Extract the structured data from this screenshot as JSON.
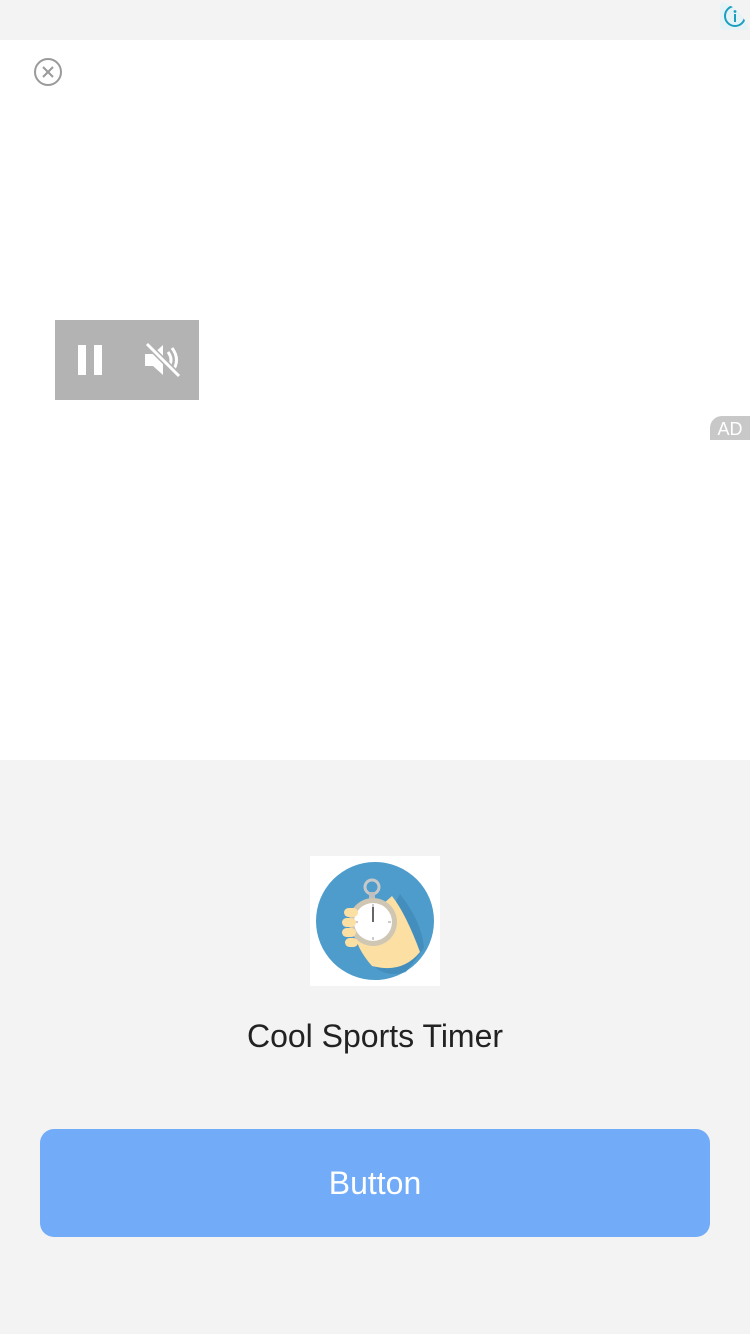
{
  "ad": {
    "tag_label": "AD",
    "info_icon": "info-icon",
    "close_icon": "close-circle-icon"
  },
  "video": {
    "pause_icon": "pause-icon",
    "mute_icon": "muted-speaker-icon"
  },
  "app": {
    "name": "Cool Sports Timer",
    "icon": "stopwatch-in-hand-icon"
  },
  "cta": {
    "label": "Button"
  },
  "colors": {
    "button": "#72abf8",
    "info_accent": "#1a9fc0",
    "icon_circle": "#4d9ccc",
    "panel_bg": "#f3f3f3"
  }
}
